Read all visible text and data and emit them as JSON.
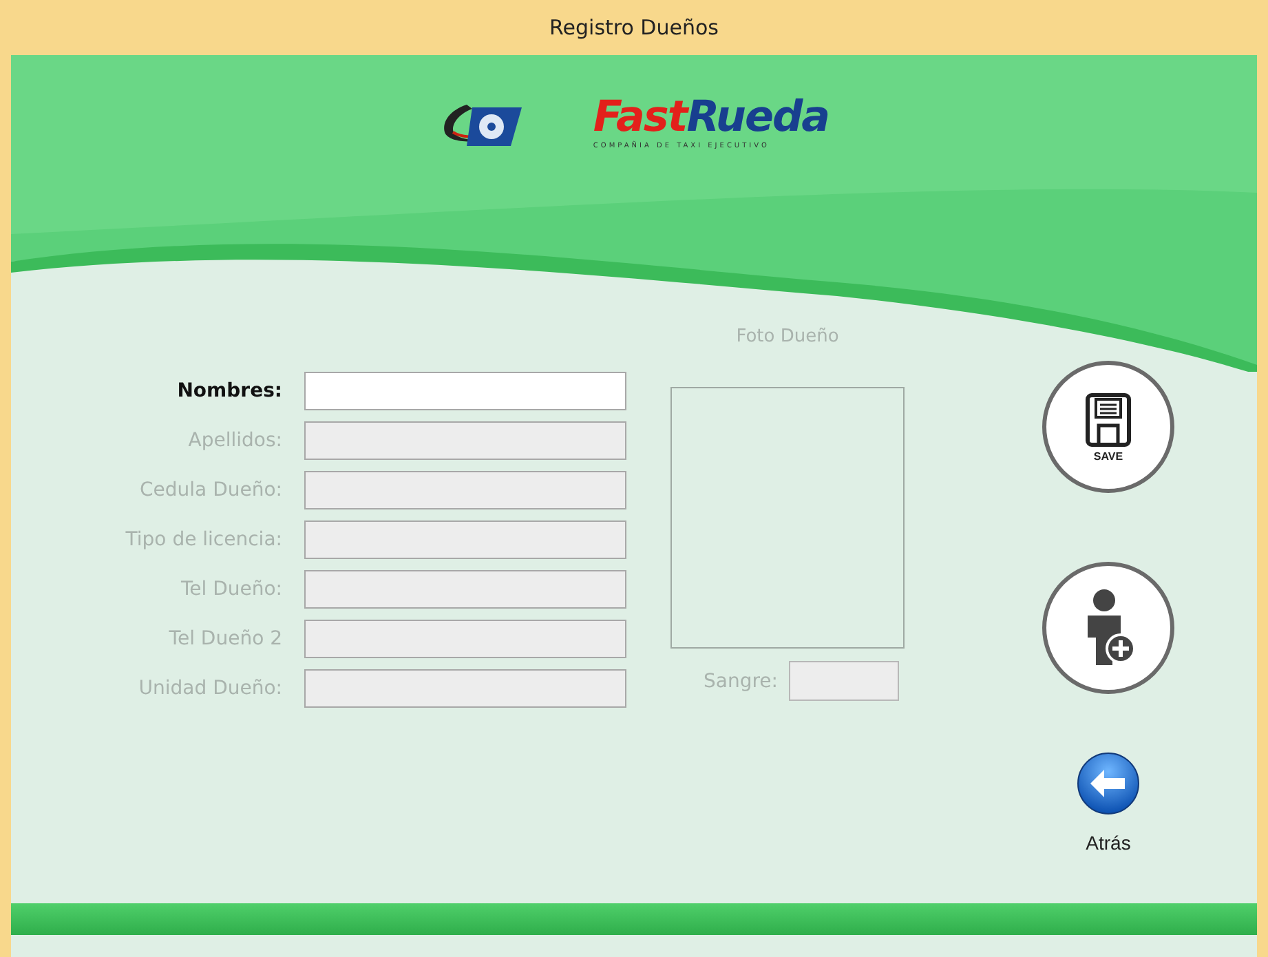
{
  "window": {
    "title": "Registro Dueños"
  },
  "logo": {
    "brand": [
      "Fast",
      "Rueda"
    ],
    "tagline": "COMPAÑIA DE TAXI EJECUTIVO"
  },
  "fields": [
    {
      "label": "Nombres:",
      "disabled": false
    },
    {
      "label": "Apellidos:",
      "disabled": true
    },
    {
      "label": "Cedula Dueño:",
      "disabled": true
    },
    {
      "label": "Tipo de licencia:",
      "disabled": true
    },
    {
      "label": "Tel Dueño:",
      "disabled": true
    },
    {
      "label": "Tel Dueño 2",
      "disabled": true
    },
    {
      "label": "Unidad Dueño:",
      "disabled": true
    }
  ],
  "photo": {
    "caption": "Foto Dueño"
  },
  "blood": {
    "label": "Sangre:",
    "disabled": true
  },
  "actions": [
    {
      "kind": "save",
      "label": "SAVE"
    },
    {
      "kind": "add_person"
    },
    {
      "kind": "back",
      "label": "Atrás"
    }
  ]
}
